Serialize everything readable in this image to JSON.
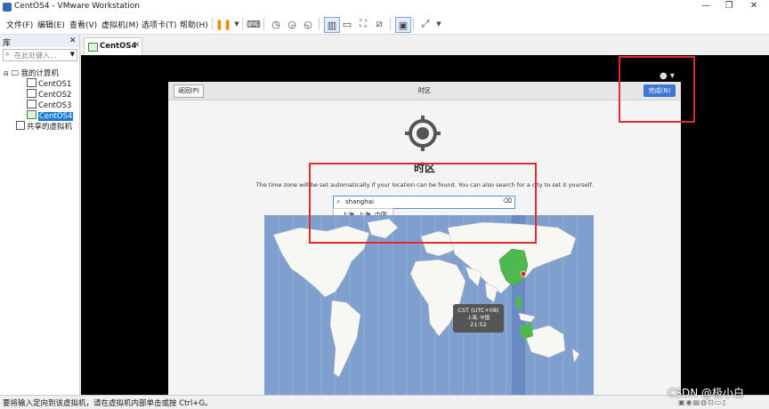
{
  "window": {
    "title": "CentOS4 - VMware Workstation",
    "minimize": "—",
    "restore": "❐",
    "close": "✕"
  },
  "menu": [
    "文件(F)",
    "编辑(E)",
    "查看(V)",
    "虚拟机(M)",
    "选项卡(T)",
    "帮助(H)"
  ],
  "library": {
    "title": "库",
    "close": "✕",
    "search_placeholder": "在此处键入...",
    "root": "我的计算机",
    "vms": [
      "CentOS1",
      "CentOS2",
      "CentOS3",
      "CentOS4"
    ],
    "selected": "CentOS4",
    "shared": "共享的虚拟机"
  },
  "tab": {
    "label": "CentOS4",
    "close": "✕"
  },
  "installer": {
    "back": "返回(P)",
    "title": "时区",
    "done": "完成(N)",
    "heading": "时区",
    "description": "The time zone will be set automatically if your location can be found. You can also search for a city to set it yourself.",
    "search_value": "shanghai",
    "suggestion": "上海, 上海, 中国",
    "tooltip": {
      "zone": "CST (UTC+08)",
      "city": "上海, 中国",
      "time": "21:52"
    }
  },
  "status": {
    "message": "要将输入定向到该虚拟机，请在虚拟机内部单击或按 Ctrl+G。"
  },
  "watermark": "CSDN @极小白",
  "colors": {
    "accent": "#3f78d4",
    "highlight_box": "#e12b2b",
    "ocean": "#7f9fcf",
    "land": "#f7f7f4",
    "selected_zone": "#4fb84f"
  }
}
